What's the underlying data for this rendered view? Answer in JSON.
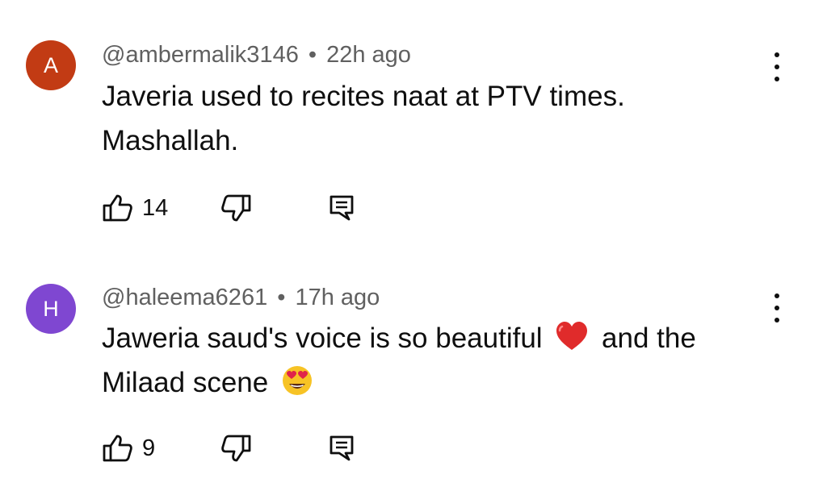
{
  "comments": [
    {
      "avatar_letter": "A",
      "avatar_color": "#c23b14",
      "handle": "@ambermalik3146",
      "separator": "•",
      "time": "22h ago",
      "text_line1": "Javeria used to recites naat at PTV times.",
      "text_line2": "Mashallah.",
      "likes": "14"
    },
    {
      "avatar_letter": "H",
      "avatar_color": "#7f47d1",
      "handle": "@haleema6261",
      "separator": "•",
      "time": "17h ago",
      "text_line1_a": "Jaweria saud's voice is so beautiful",
      "emoji_1": "red-heart",
      "text_line1_b": "and the",
      "text_line2": "Milaad scene",
      "emoji_2": "heart-eyes",
      "likes": "9"
    }
  ]
}
